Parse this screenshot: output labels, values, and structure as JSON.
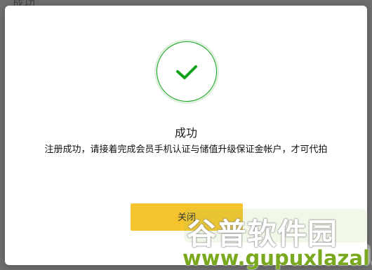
{
  "background": {
    "partial_text": "成功"
  },
  "modal": {
    "status_icon": "checkmark-circle-icon",
    "title": "成功",
    "message": "注册成功，请接着完成会员手机认证与储值升级保证金帐户，才可代拍",
    "close_label": "关闭"
  },
  "watermark": {
    "cn_text": "谷普软件园",
    "url_text": "www.gupuxlazal.com"
  },
  "colors": {
    "success": "#12a21a",
    "button": "#f6c42f"
  }
}
